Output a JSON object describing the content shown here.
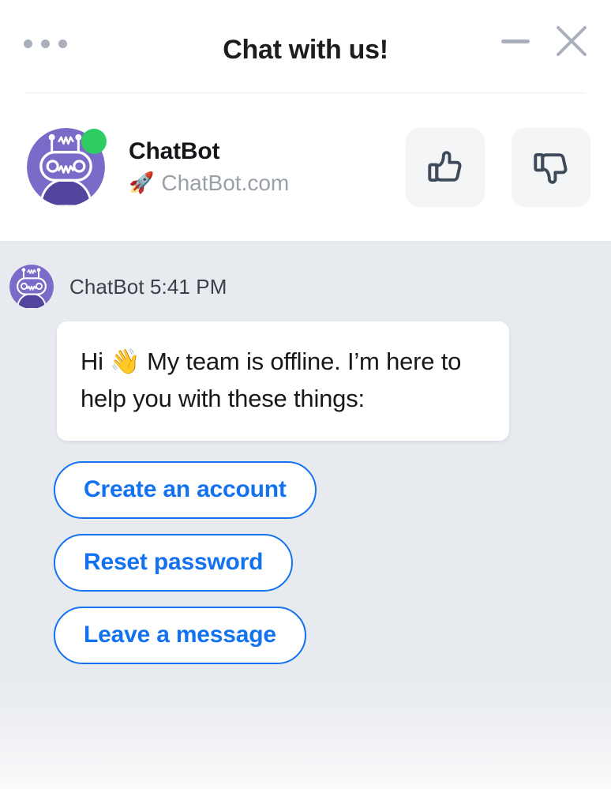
{
  "titlebar": {
    "title": "Chat with us!",
    "menu_icon": "more-horizontal-icon",
    "minimize_icon": "minimize-icon",
    "close_icon": "close-icon"
  },
  "bot_header": {
    "avatar_icon": "chatbot-avatar-icon",
    "status": "online",
    "name": "ChatBot",
    "site_emoji": "🚀",
    "site": "ChatBot.com",
    "rating": {
      "like_icon": "thumbs-up-icon",
      "dislike_icon": "thumbs-down-icon"
    }
  },
  "conversation": {
    "message": {
      "avatar_icon": "chatbot-avatar-icon",
      "author": "ChatBot",
      "time": "5:41 PM",
      "meta": "ChatBot 5:41 PM",
      "text": "Hi 👋 My team is offline. I’m here to help you with these things:"
    },
    "quick_replies": [
      {
        "label": "Create an account"
      },
      {
        "label": "Reset password"
      },
      {
        "label": "Leave a message"
      }
    ]
  },
  "colors": {
    "accent_blue": "#1372f0",
    "avatar_purple": "#7a6bc8",
    "avatar_purple_dark": "#53449e",
    "status_green": "#2ecc62",
    "conversation_bg": "#e7eaef",
    "icon_gray": "#aab0bb",
    "icon_slate": "#3e4a59"
  }
}
